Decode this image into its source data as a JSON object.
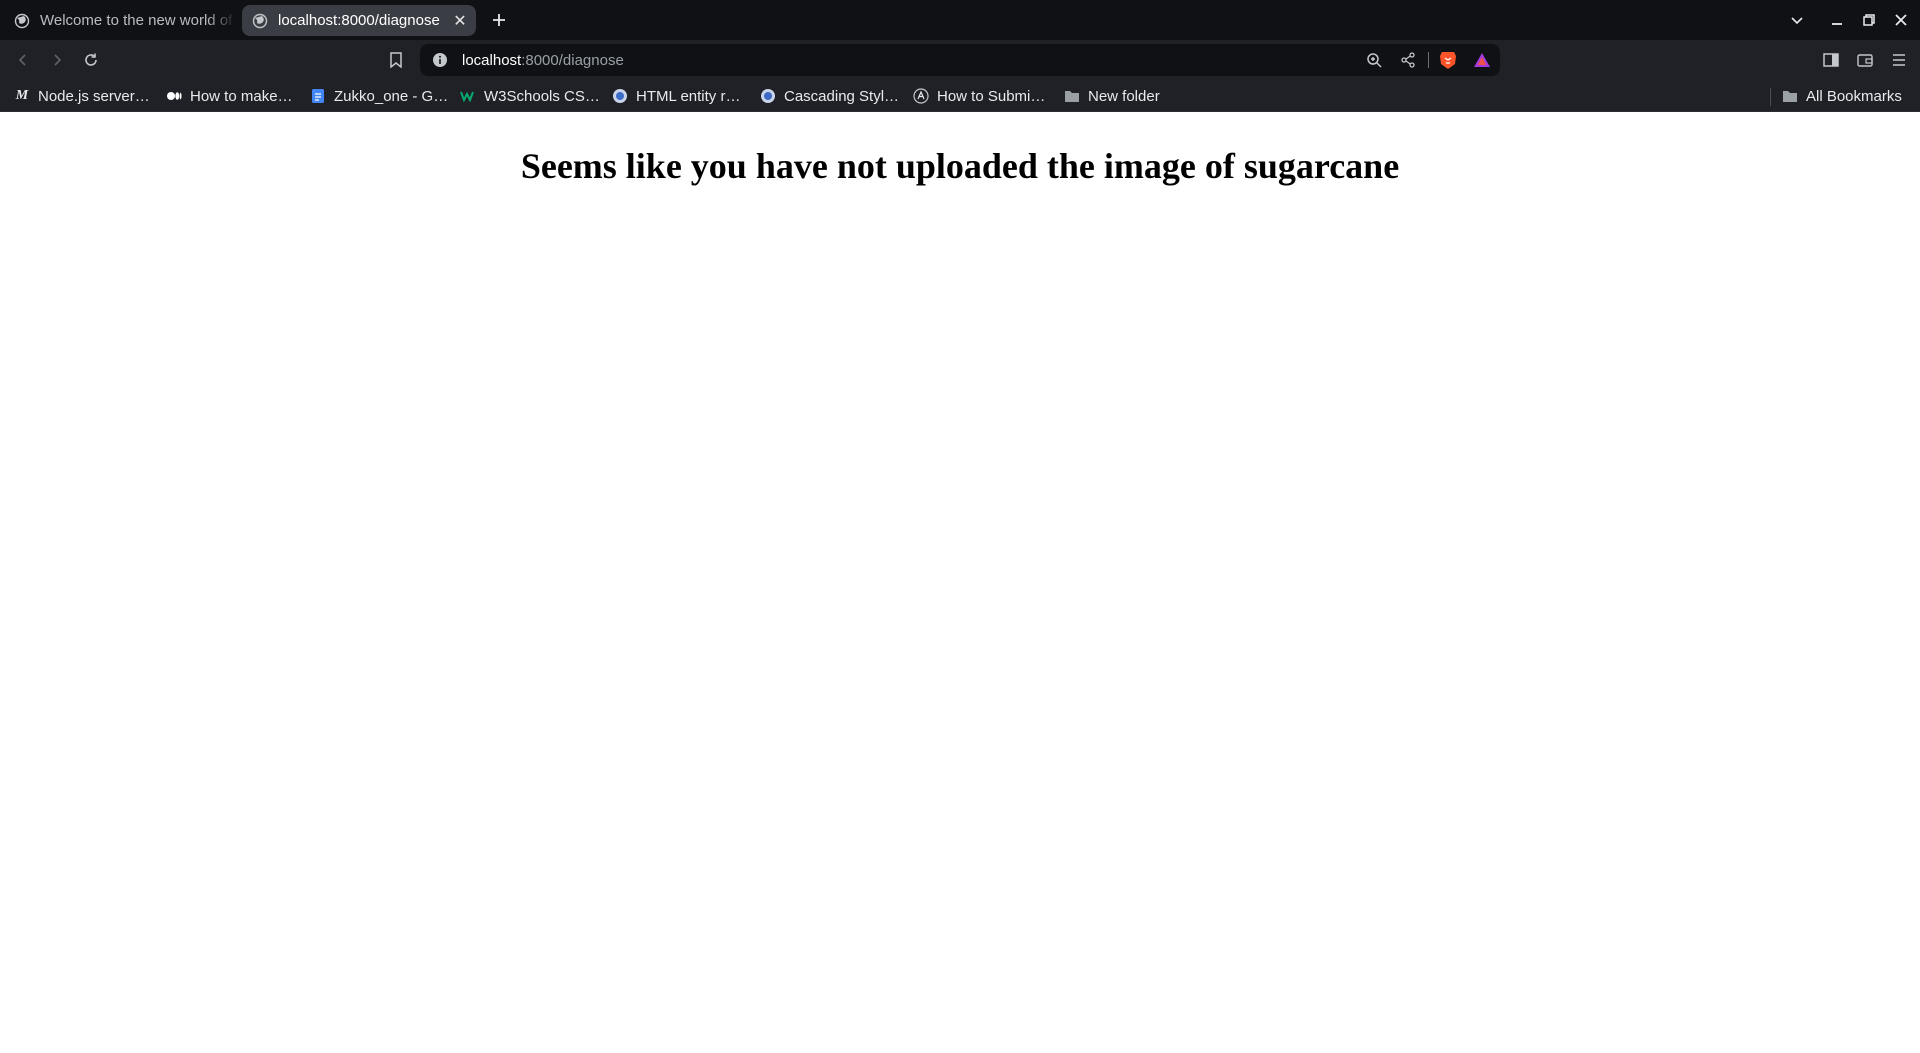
{
  "browser": {
    "tabs": [
      {
        "title": "Welcome to the new world of",
        "active": false,
        "icon": "globe-icon"
      },
      {
        "title": "localhost:8000/diagnose",
        "active": true,
        "icon": "globe-icon"
      }
    ],
    "close_glyph": "✕"
  },
  "address_bar": {
    "host": "localhost",
    "path": ":8000/diagnose"
  },
  "bookmarks": [
    {
      "label": "Node.js server…",
      "icon": "medium-icon"
    },
    {
      "label": "How to make…",
      "icon": "medium-dots-icon"
    },
    {
      "label": "Zukko_one - G…",
      "icon": "google-docs-icon"
    },
    {
      "label": "W3Schools CS…",
      "icon": "w3schools-icon"
    },
    {
      "label": "HTML entity r…",
      "icon": "site-icon"
    },
    {
      "label": "Cascading Styl…",
      "icon": "site-icon"
    },
    {
      "label": "How to Submi…",
      "icon": "angular-icon"
    },
    {
      "label": "New folder",
      "icon": "folder-icon"
    }
  ],
  "all_bookmarks": "All Bookmarks",
  "page": {
    "heading": "Seems like you have not uploaded the image of sugarcane"
  },
  "colors": {
    "tabstrip": "#0f1115",
    "toolbar": "#1f2127",
    "active_tab": "#3a3d43",
    "brave_lion": "#fb542b"
  }
}
